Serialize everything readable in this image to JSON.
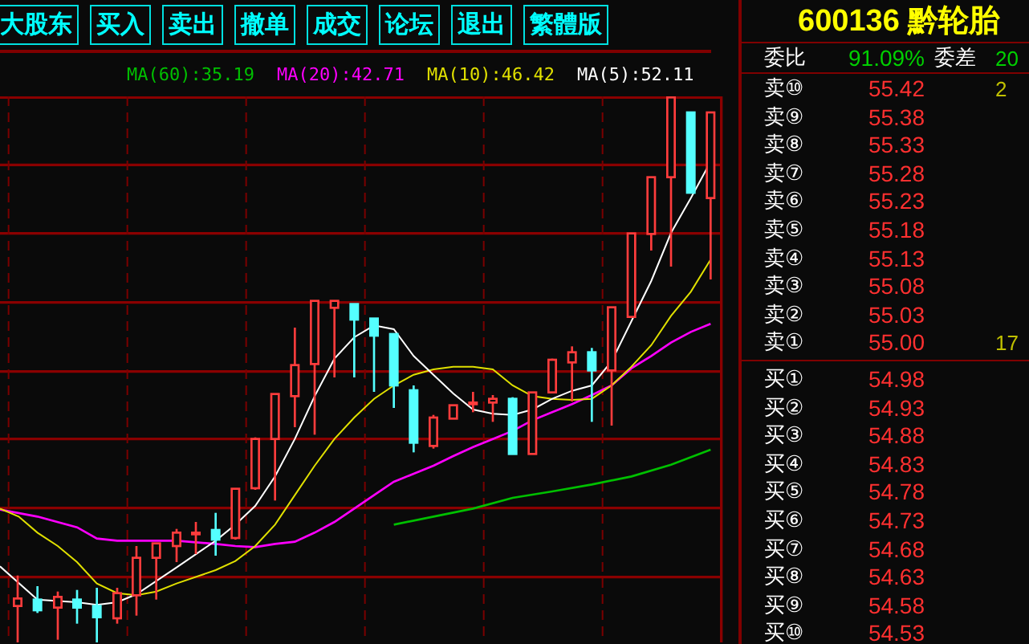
{
  "menu": [
    {
      "label": "大股东"
    },
    {
      "label": "买入"
    },
    {
      "label": "卖出"
    },
    {
      "label": "撤单"
    },
    {
      "label": "成交"
    },
    {
      "label": "论坛"
    },
    {
      "label": "退出"
    },
    {
      "label": "繁體版"
    }
  ],
  "ma_legend": [
    {
      "text": "MA(60):35.19",
      "color": "#00c000"
    },
    {
      "text": "MA(20):42.71",
      "color": "#ff00ff"
    },
    {
      "text": "MA(10):46.42",
      "color": "#e0e000"
    },
    {
      "text": "MA(5):52.11",
      "color": "#ffffff"
    }
  ],
  "quote": {
    "title": "600136 黔轮胎",
    "ratio_label": "委比",
    "ratio_value": "91.09%",
    "diff_label": "委差",
    "diff_value": "20"
  },
  "sell": [
    {
      "label": "卖⑩",
      "price": "55.42",
      "volume": "2"
    },
    {
      "label": "卖⑨",
      "price": "55.38"
    },
    {
      "label": "卖⑧",
      "price": "55.33"
    },
    {
      "label": "卖⑦",
      "price": "55.28"
    },
    {
      "label": "卖⑥",
      "price": "55.23"
    },
    {
      "label": "卖⑤",
      "price": "55.18"
    },
    {
      "label": "卖④",
      "price": "55.13"
    },
    {
      "label": "卖③",
      "price": "55.08"
    },
    {
      "label": "卖②",
      "price": "55.03"
    },
    {
      "label": "卖①",
      "price": "55.00",
      "volume": "17"
    }
  ],
  "buy": [
    {
      "label": "买①",
      "price": "54.98"
    },
    {
      "label": "买②",
      "price": "54.93"
    },
    {
      "label": "买③",
      "price": "54.88"
    },
    {
      "label": "买④",
      "price": "54.83"
    },
    {
      "label": "买⑤",
      "price": "54.78"
    },
    {
      "label": "买⑥",
      "price": "54.73"
    },
    {
      "label": "买⑦",
      "price": "54.68"
    },
    {
      "label": "买⑧",
      "price": "54.63"
    },
    {
      "label": "买⑨",
      "price": "54.58"
    },
    {
      "label": "买⑩",
      "price": "54.53"
    }
  ]
}
